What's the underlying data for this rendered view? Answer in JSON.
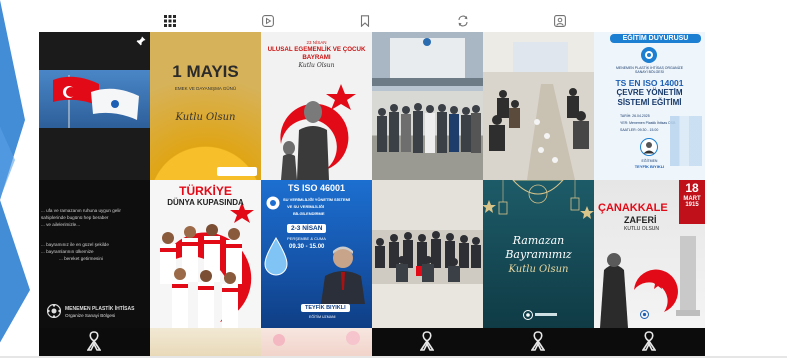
{
  "tabs": [
    {
      "name": "tab-posts",
      "icon": "grid-icon",
      "active": true
    },
    {
      "name": "tab-reels",
      "icon": "reels-icon",
      "active": false
    },
    {
      "name": "tab-saved",
      "icon": "bookmark-icon",
      "active": false
    },
    {
      "name": "tab-reposts",
      "icon": "repost-icon",
      "active": false
    },
    {
      "name": "tab-tagged",
      "icon": "tagged-icon",
      "active": false
    }
  ],
  "posts": {
    "mayis": {
      "title": "1 MAYIS",
      "subtitle": "EMEK VE DAYANIŞMA GÜNÜ",
      "script": "Kutlu Olsun"
    },
    "nisan": {
      "line1": "23 NİSAN",
      "line2": "ULUSAL EGEMENLİK VE ÇOCUK",
      "line3": "BAYRAMI",
      "script": "Kutlu Olsun"
    },
    "egitim": {
      "banner": "EĞİTİM DUYURUSU",
      "org": "MENEMEN PLASTİK İHTİSAS ORGANİZE SANAYİ BÖLGESİ",
      "title1": "TS EN ISO 14001",
      "title2": "ÇEVRE YÖNETİM",
      "title3": "SİSTEMİ EĞİTİMİ",
      "date": "TARİH: 26.04.2025",
      "place": "YER: Menemen Plastik İhtisas OSB",
      "hours": "SAATLER: 09.30 - 15.00",
      "presenter": "EĞİTMEN",
      "presenter_name": "TEYFİK BIYIKLI"
    },
    "textpost": {
      "line1": "... ufa ve ramazanın ruhuna uygun gelir",
      "line2": "sahiplerinde bugünü hep beraber",
      "line3": "... ve ailelerimizle...",
      "line4": "... bayramınız ile en güzel şekilde",
      "line5": "... bayramlarının ülkemize",
      "line6": "... bereket getirmesini",
      "org1": "MENEMEN PLASTİK İHTİSAS",
      "org2": "Organize Sanayi Bölgesi"
    },
    "turkiye": {
      "line1": "TÜRKİYE",
      "line2": "DÜNYA KUPASINDA"
    },
    "iso46001": {
      "title": "TS ISO 46001",
      "sub1": "SU VERİMLİLİĞİ YÖNETİM SİSTEMİ",
      "sub2": "VE SU VERİMLİLİĞİ",
      "sub3": "BİLGİLENDİRME",
      "date": "2-3 NİSAN",
      "day": "PERŞEMBE & CUMA",
      "hours": "09.30 - 15.00",
      "presenter": "TEYFİK BIYIKLI",
      "role": "EĞİTİM UZMANI"
    },
    "ramazan": {
      "line1": "Ramazan",
      "line2": "Bayramımız",
      "line3": "Kutlu Olsun"
    },
    "canakkale": {
      "line1": "ÇANAKKALE",
      "line2": "ZAFERİ",
      "line3": "KUTLU OLSUN",
      "day": "18",
      "month": "MART",
      "year": "1915"
    }
  },
  "colors": {
    "red": "#e30a17",
    "blue": "#1c5fb5",
    "navy": "#173a6b",
    "yellow": "#f1c40f",
    "teal": "#114a57"
  }
}
